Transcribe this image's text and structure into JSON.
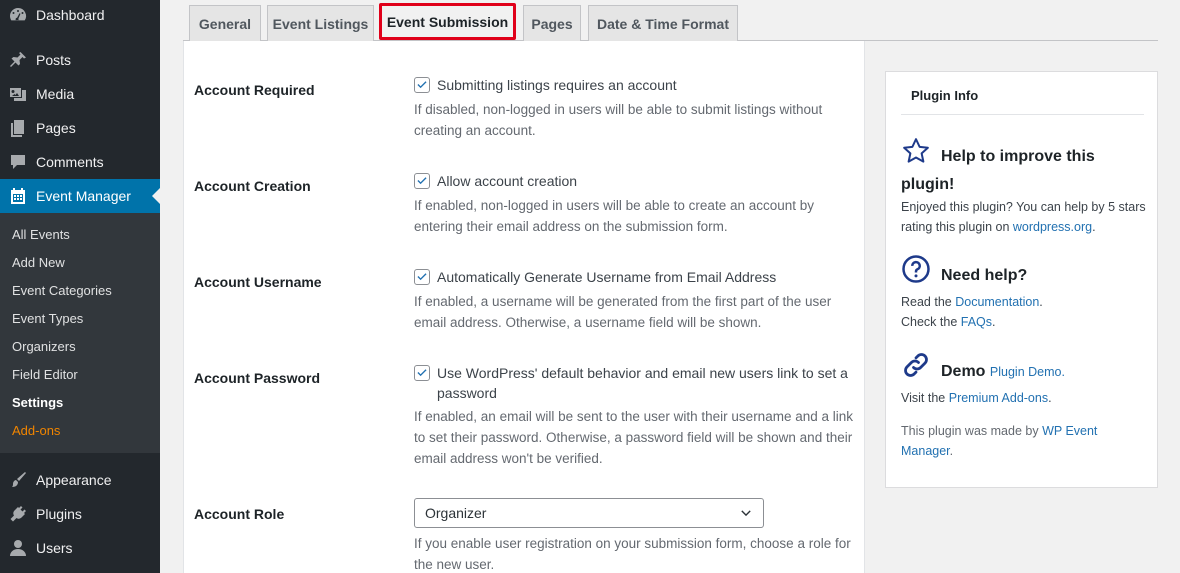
{
  "sidebar": {
    "items": [
      {
        "label": "Dashboard",
        "icon": "dashboard-icon"
      },
      {
        "label": "Posts",
        "icon": "pin-icon"
      },
      {
        "label": "Media",
        "icon": "media-icon"
      },
      {
        "label": "Pages",
        "icon": "pages-icon"
      },
      {
        "label": "Comments",
        "icon": "comment-icon"
      },
      {
        "label": "Event Manager",
        "icon": "calendar-icon"
      },
      {
        "label": "Appearance",
        "icon": "brush-icon"
      },
      {
        "label": "Plugins",
        "icon": "plug-icon"
      },
      {
        "label": "Users",
        "icon": "user-icon"
      }
    ],
    "submenu": [
      "All Events",
      "Add New",
      "Event Categories",
      "Event Types",
      "Organizers",
      "Field Editor",
      "Settings",
      "Add-ons"
    ],
    "active_color": "#0073aa",
    "addons_color": "#f18500"
  },
  "tabs": [
    "General",
    "Event Listings",
    "Event Submission",
    "Pages",
    "Date & Time Format"
  ],
  "form": {
    "account_required": {
      "label": "Account Required",
      "checkbox": "Submitting listings requires an account",
      "desc": "If disabled, non-logged in users will be able to submit listings without creating an account."
    },
    "account_creation": {
      "label": "Account Creation",
      "checkbox": "Allow account creation",
      "desc": "If enabled, non-logged in users will be able to create an account by entering their email address on the submission form."
    },
    "account_username": {
      "label": "Account Username",
      "checkbox": "Automatically Generate Username from Email Address",
      "desc": "If enabled, a username will be generated from the first part of the user email address. Otherwise, a username field will be shown."
    },
    "account_password": {
      "label": "Account Password",
      "checkbox": "Use WordPress' default behavior and email new users link to set a password",
      "desc": "If enabled, an email will be sent to the user with their username and a link to set their password. Otherwise, a password field will be shown and their email address won't be verified."
    },
    "account_role": {
      "label": "Account Role",
      "selected": "Organizer",
      "desc": "If you enable user registration on your submission form, choose a role for the new user."
    }
  },
  "plugin_info": {
    "title": "Plugin Info",
    "help_title": "Help to improve this plugin!",
    "help_text_pre": "Enjoyed this plugin? You can help by 5 stars rating this plugin on",
    "help_link": "wordpress.org",
    "help_text_post": ".",
    "need_help_title": "Need help?",
    "read_the": "Read the",
    "documentation": "Documentation",
    "check_the": "Check the",
    "faqs": "FAQs",
    "period": ".",
    "demo_title": "Demo",
    "plugin_demo": "Plugin Demo.",
    "visit_the": "Visit the",
    "premium_addons": "Premium Add-ons",
    "made_by": "This plugin was made by",
    "author": "WP Event Manager"
  }
}
